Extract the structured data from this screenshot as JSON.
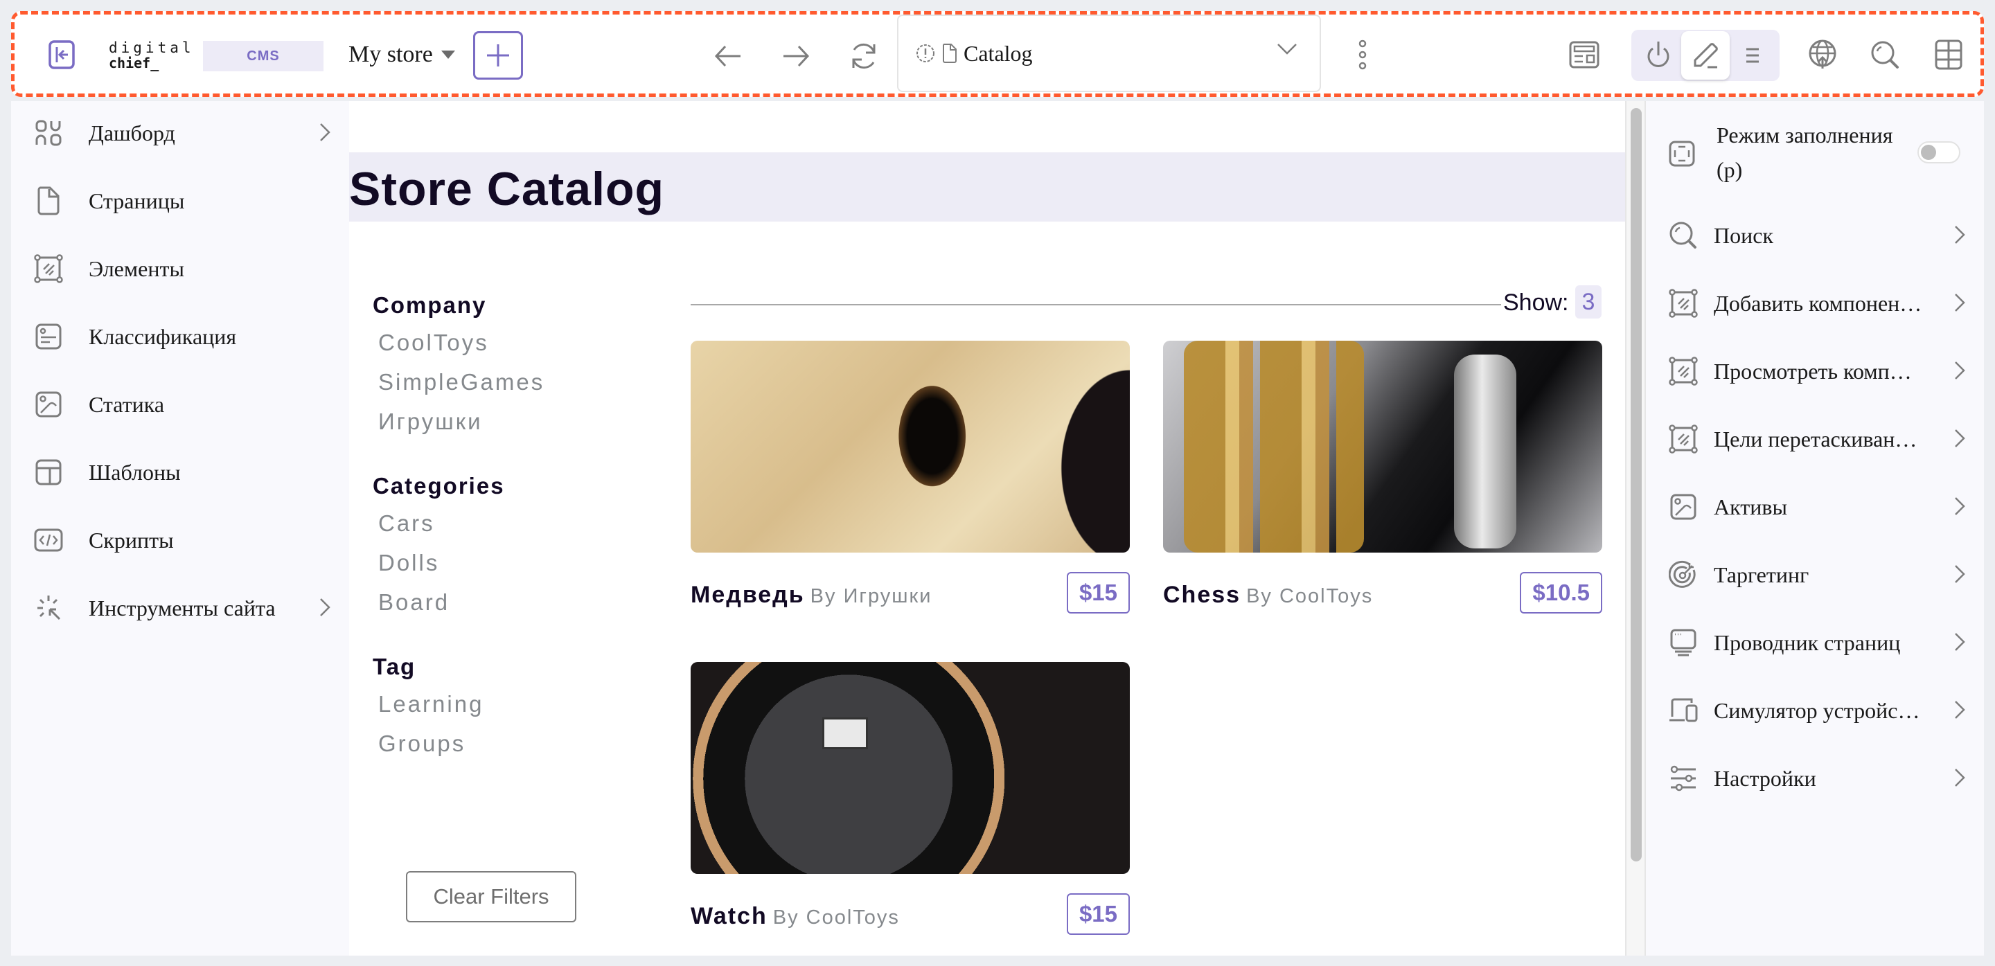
{
  "topbar": {
    "logo_line1": "digital",
    "logo_line2": "chief_",
    "product_badge": "CMS",
    "store_select": "My store",
    "page_select": "Catalog",
    "accent_color": "#7a6cc4",
    "highlight_border_color": "#ff5a2f",
    "icons": [
      "collapse-sidebar-icon",
      "plus-icon",
      "arrow-left-icon",
      "arrow-right-icon",
      "refresh-icon",
      "page-status-icon",
      "page-icon",
      "chevron-down-icon",
      "more-vertical-icon",
      "layout-icon",
      "power-icon",
      "pencil-icon",
      "list-icon",
      "globe-publish-icon",
      "search-icon",
      "grid-icon"
    ],
    "active_mode": "edit"
  },
  "left_sidebar": {
    "items": [
      {
        "label": "Дашборд",
        "icon": "dashboard-icon",
        "has_submenu": true
      },
      {
        "label": "Страницы",
        "icon": "page-icon",
        "has_submenu": false
      },
      {
        "label": "Элементы",
        "icon": "component-icon",
        "has_submenu": false
      },
      {
        "label": "Классификация",
        "icon": "classification-icon",
        "has_submenu": false
      },
      {
        "label": "Статика",
        "icon": "image-icon",
        "has_submenu": false
      },
      {
        "label": "Шаблоны",
        "icon": "template-icon",
        "has_submenu": false
      },
      {
        "label": "Скрипты",
        "icon": "code-icon",
        "has_submenu": false
      },
      {
        "label": "Инструменты сайта",
        "icon": "tools-icon",
        "has_submenu": true
      }
    ]
  },
  "main": {
    "title": "Store Catalog",
    "filters": [
      {
        "heading": "Company",
        "options": [
          "CoolToys",
          "SimpleGames",
          "Игрушки"
        ]
      },
      {
        "heading": "Categories",
        "options": [
          "Cars",
          "Dolls",
          "Board"
        ]
      },
      {
        "heading": "Tag",
        "options": [
          "Learning",
          "Groups"
        ]
      }
    ],
    "clear_filters_label": "Clear Filters",
    "show_label": "Show:",
    "show_value": "3",
    "products": [
      {
        "name": "Медведь",
        "by": "By Игрушки",
        "price": "$15",
        "image": "teddy-bear-closeup"
      },
      {
        "name": "Chess",
        "by": "By CoolToys",
        "price": "$10.5",
        "image": "gold-silver-chess-pieces"
      },
      {
        "name": "Watch",
        "by": "By CoolToys",
        "price": "$15",
        "image": "luxury-wristwatch"
      }
    ]
  },
  "right_sidebar": {
    "fill_mode_label": "Режим заполнения (p)",
    "fill_mode_on": false,
    "items": [
      {
        "label": "Поиск",
        "icon": "search-icon"
      },
      {
        "label": "Добавить компонен…",
        "icon": "component-icon"
      },
      {
        "label": "Просмотреть комп…",
        "icon": "component-icon"
      },
      {
        "label": "Цели перетаскиван…",
        "icon": "component-icon"
      },
      {
        "label": "Активы",
        "icon": "image-icon"
      },
      {
        "label": "Таргетинг",
        "icon": "target-icon"
      },
      {
        "label": "Проводник страниц",
        "icon": "monitor-icon"
      },
      {
        "label": "Симулятор устройс…",
        "icon": "devices-icon"
      },
      {
        "label": "Настройки",
        "icon": "sliders-icon"
      }
    ]
  }
}
